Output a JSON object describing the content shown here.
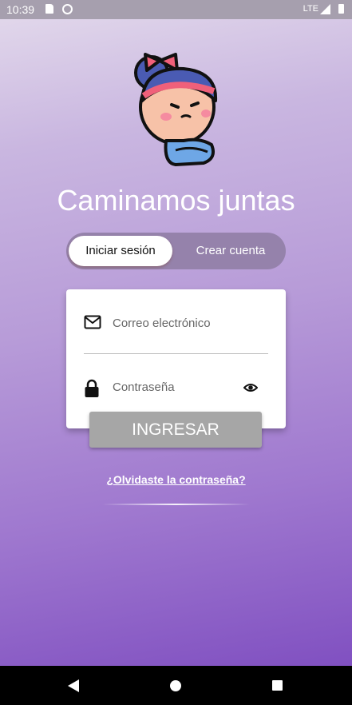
{
  "status_bar": {
    "time": "10:39",
    "network": "LTE"
  },
  "app": {
    "title": "Caminamos juntas"
  },
  "tabs": [
    {
      "label": "Iniciar sesión",
      "active": true
    },
    {
      "label": "Crear cuenta",
      "active": false
    }
  ],
  "form": {
    "email_placeholder": "Correo electrónico",
    "password_placeholder": "Contraseña",
    "submit_label": "INGRESAR"
  },
  "links": {
    "forgot_password": "¿Olvidaste la contraseña?"
  },
  "colors": {
    "gradient_top": "#e4dbec",
    "gradient_bottom": "#7a48be",
    "tab_bg": "#9582ab",
    "button_disabled": "#a6a6a6"
  },
  "icons": [
    "mail-icon",
    "lock-icon",
    "eye-icon",
    "mascot-girl"
  ]
}
